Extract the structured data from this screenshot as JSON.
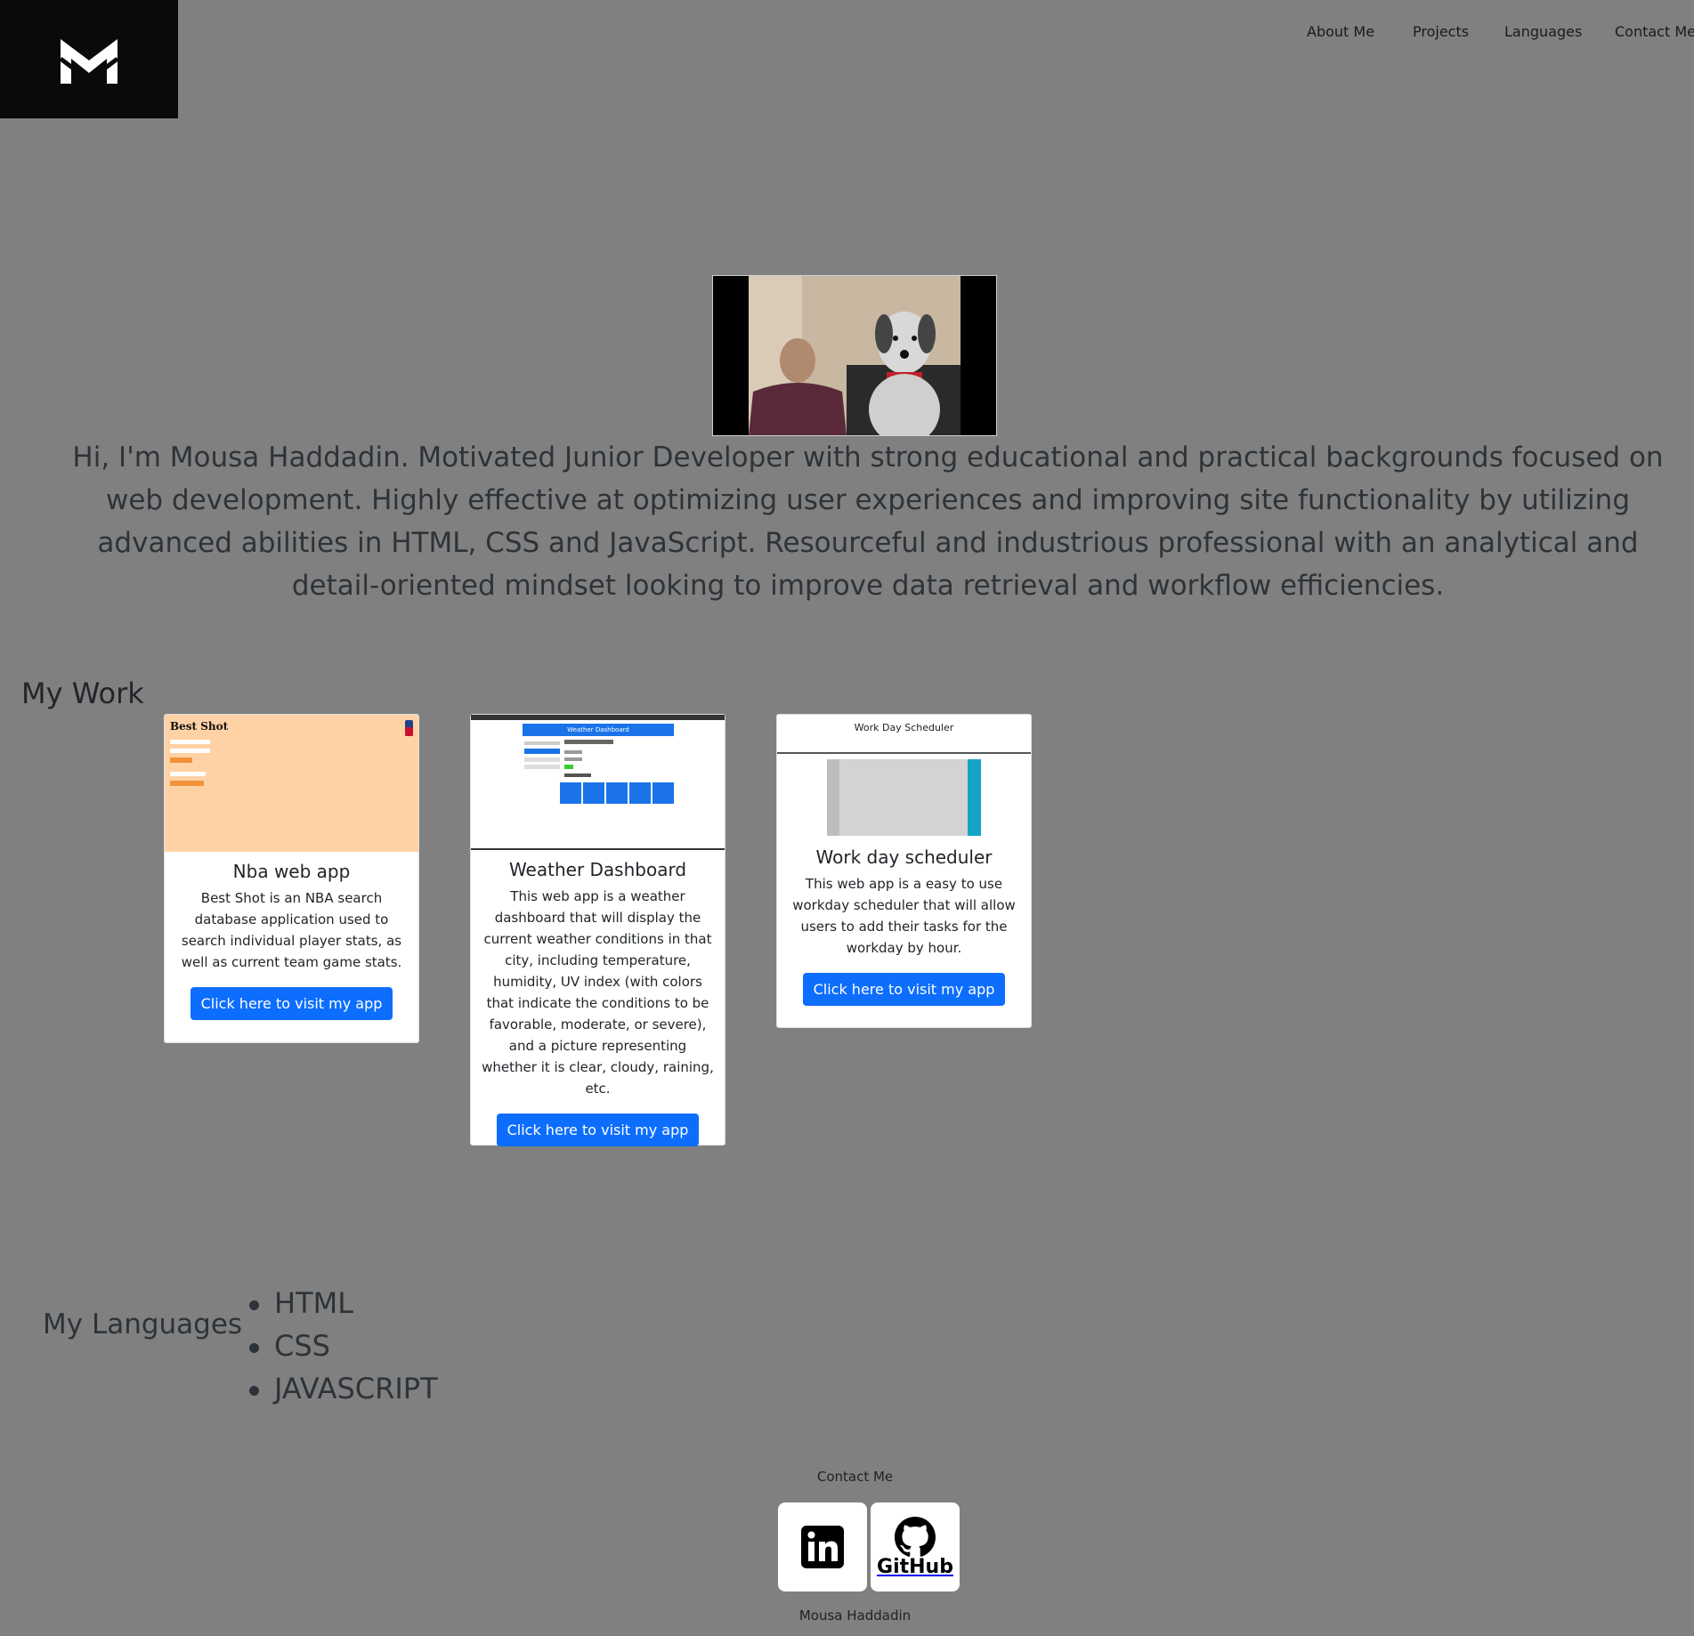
{
  "brand": {
    "logo_icon": "mh-monogram-logo"
  },
  "nav": {
    "items": [
      "About Me",
      "Projects",
      "Languages",
      "Contact Me"
    ]
  },
  "hero": {
    "photo_desc_icon": "profile-photo",
    "bio": "Hi, I'm Mousa Haddadin. Motivated Junior Developer with strong educational and practical backgrounds focused on web development. Highly effective at optimizing user experiences and improving site functionality by utilizing advanced abilities in HTML, CSS and JavaScript. Resourceful and industrious professional with an analytical and detail-oriented mindset looking to improve data retrieval and workflow efficiencies."
  },
  "work": {
    "heading": "My Work",
    "projects": [
      {
        "title": "Nba web app",
        "description": "Best Shot is an NBA search database application used to search individual player stats, as well as current team game stats.",
        "button": "Click here to visit my app",
        "thumb_title": "Best Shot"
      },
      {
        "title": "Weather Dashboard",
        "description": "This web app is a weather dashboard that will display the current weather conditions in that city, including temperature, humidity, UV index (with colors that indicate the conditions to be favorable, moderate, or severe), and a picture representing whether it is clear, cloudy, raining, etc.",
        "button": "Click here to visit my app",
        "thumb_title": "Weather Dashboard"
      },
      {
        "title": "Work day scheduler",
        "description": "This web app is a easy to use workday scheduler that will allow users to add their tasks for the workday by hour.",
        "button": "Click here to visit my app",
        "thumb_title": "Work Day Scheduler"
      }
    ]
  },
  "languages": {
    "heading": "My Languages",
    "items": [
      "HTML",
      "CSS",
      "JAVASCRIPT"
    ]
  },
  "contact": {
    "heading": "Contact Me",
    "links": [
      {
        "icon": "linkedin-icon"
      },
      {
        "icon": "github-icon",
        "label": "GitHub"
      }
    ]
  },
  "footer": {
    "name": "Mousa Haddadin"
  },
  "colors": {
    "background": "#808080",
    "button": "#0d6efd",
    "logo_bg": "#0a0a0a"
  }
}
